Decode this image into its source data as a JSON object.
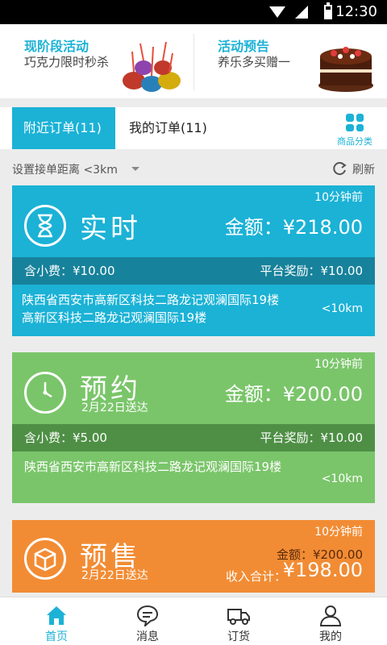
{
  "status_bar": {
    "time": "12:30"
  },
  "promo": [
    {
      "title": "现阶段活动",
      "subtitle": "巧克力限时秒杀",
      "image": "chocolates"
    },
    {
      "title": "活动预告",
      "subtitle": "养乐多买赠一",
      "image": "cake"
    }
  ],
  "tabs": {
    "nearby": "附近订单(11)",
    "mine": "我的订单(11)",
    "category_label": "商品分类"
  },
  "filter": {
    "distance_label": "设置接单距离 <3km",
    "refresh_label": "刷新"
  },
  "orders": [
    {
      "time_ago": "10分钟前",
      "type": "实时",
      "icon": "hourglass-icon",
      "amount": "金额：¥218.00",
      "tip": "含小费：¥10.00",
      "reward": "平台奖励：¥10.00",
      "address_line1": "陕西省西安市高新区科技二路龙记观澜国际19楼",
      "address_line2": "高新区科技二路龙记观澜国际19楼",
      "distance": "<10km",
      "color": "#1bb2d6"
    },
    {
      "time_ago": "10分钟前",
      "type": "预约",
      "icon": "clock-icon",
      "delivery_date": "2月22日送达",
      "amount": "金额：¥200.00",
      "tip": "含小费：¥5.00",
      "reward": "平台奖励：¥10.00",
      "address_line1": "陕西省西安市高新区科技二路龙记观澜国际19楼",
      "distance": "<10km",
      "color": "#7ac56a"
    },
    {
      "time_ago": "10分钟前",
      "type": "预售",
      "icon": "box-icon",
      "delivery_date": "2月22日送达",
      "amount": "金额：¥200.00",
      "income_label": "收入合计：",
      "income_total": "¥198.00",
      "color": "#f28c34"
    }
  ],
  "bottom_nav": [
    {
      "label": "首页",
      "icon": "home-icon",
      "active": true
    },
    {
      "label": "消息",
      "icon": "message-icon",
      "active": false
    },
    {
      "label": "订货",
      "icon": "truck-icon",
      "active": false
    },
    {
      "label": "我的",
      "icon": "user-icon",
      "active": false
    }
  ]
}
